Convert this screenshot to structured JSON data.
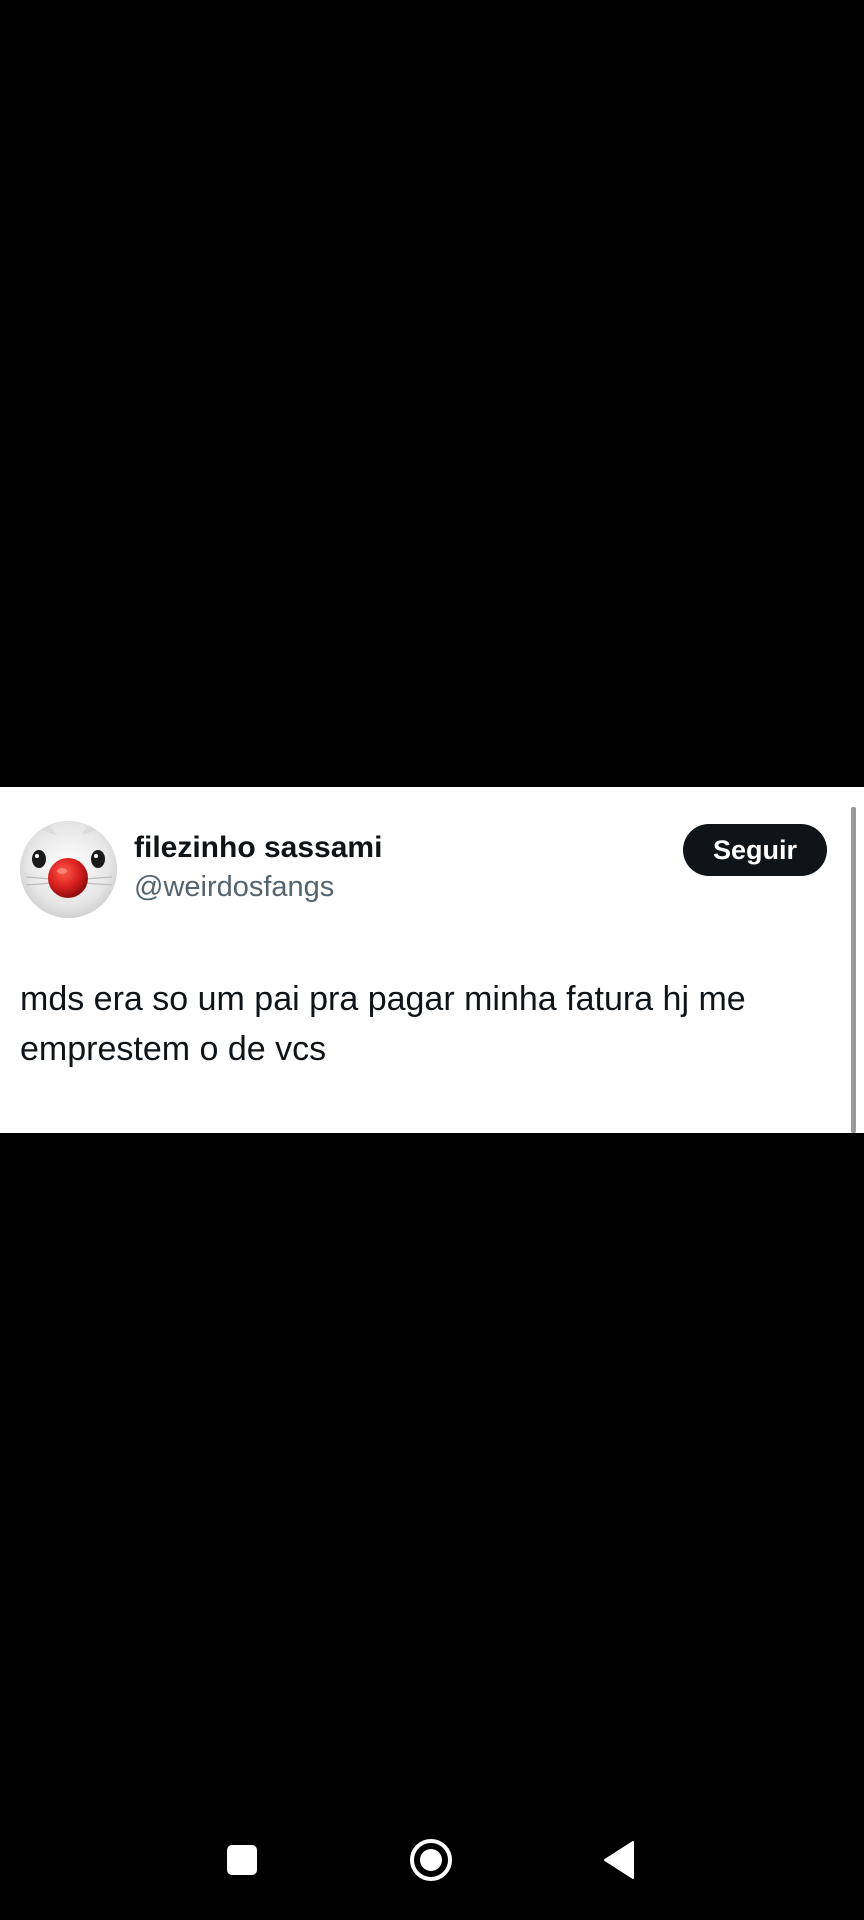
{
  "tweet": {
    "display_name": "filezinho sassami",
    "handle": "@weirdosfangs",
    "follow_label": "Seguir",
    "text": "mds era so um pai pra pagar minha fatura hj me emprestem o de vcs"
  },
  "colors": {
    "text_primary": "#0f1419",
    "text_secondary": "#536471",
    "button_bg": "#0f1419",
    "card_bg": "#ffffff",
    "screen_bg": "#000000",
    "clown_nose": "#d81f1f"
  },
  "navigation": {
    "recents_icon": "square-icon",
    "home_icon": "circle-home-icon",
    "back_icon": "triangle-back-icon"
  }
}
